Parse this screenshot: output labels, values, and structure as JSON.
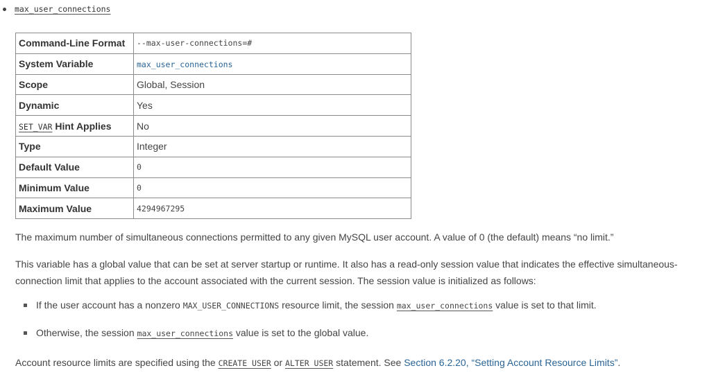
{
  "heading": "max_user_connections",
  "table": [
    {
      "key": "Command-Line Format",
      "value": "--max-user-connections=#",
      "mono": true,
      "link": false
    },
    {
      "key": "System Variable",
      "value": "max_user_connections",
      "mono": true,
      "link": true
    },
    {
      "key": "Scope",
      "value": "Global, Session",
      "mono": false,
      "link": false
    },
    {
      "key": "Dynamic",
      "value": "Yes",
      "mono": false,
      "link": false
    },
    {
      "key_code": "SET_VAR",
      "key_rest": " Hint Applies",
      "value": "No",
      "mono": false,
      "link": false
    },
    {
      "key": "Type",
      "value": "Integer",
      "mono": false,
      "link": false
    },
    {
      "key": "Default Value",
      "value": "0",
      "mono": true,
      "link": false
    },
    {
      "key": "Minimum Value",
      "value": "0",
      "mono": true,
      "link": false
    },
    {
      "key": "Maximum Value",
      "value": "4294967295",
      "mono": true,
      "link": false
    }
  ],
  "para1": "The maximum number of simultaneous connections permitted to any given MySQL user account. A value of 0 (the default) means “no limit.”",
  "para2": "This variable has a global value that can be set at server startup or runtime. It also has a read-only session value that indicates the effective simultaneous-connection limit that applies to the account associated with the current session. The session value is initialized as follows:",
  "bullet1": {
    "t1": "If the user account has a nonzero ",
    "c1": "MAX_USER_CONNECTIONS",
    "t2": " resource limit, the session ",
    "c2": "max_user_connections",
    "t3": " value is set to that limit."
  },
  "bullet2": {
    "t1": "Otherwise, the session ",
    "c1": "max_user_connections",
    "t2": " value is set to the global value."
  },
  "para3": {
    "t1": "Account resource limits are specified using the ",
    "c1": "CREATE USER",
    "t2": " or ",
    "c2": "ALTER USER",
    "t3": " statement. See ",
    "link": "Section 6.2.20, “Setting Account Resource Limits”",
    "t4": "."
  }
}
